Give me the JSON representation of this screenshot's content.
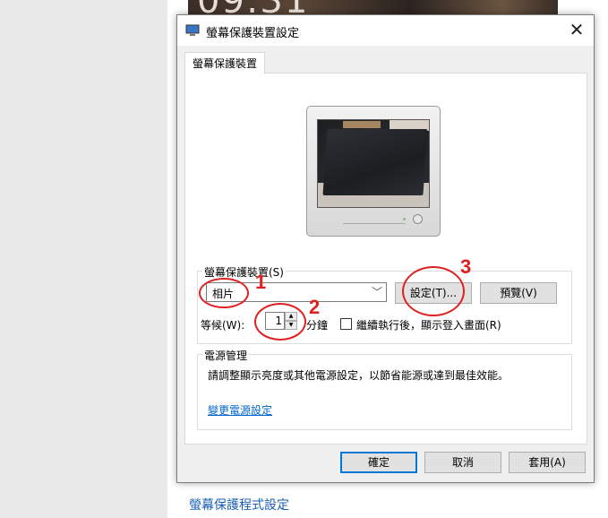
{
  "background": {
    "clock_text": "09:31",
    "screensaver_settings_link": "螢幕保護程式設定"
  },
  "dialog": {
    "title": "螢幕保護裝置設定",
    "close_glyph": "✕",
    "tab_label": "螢幕保護裝置",
    "screensaver_group_label": "螢幕保護裝置(S)",
    "screensaver_selected": "相片",
    "settings_button": "設定(T)...",
    "preview_button": "預覽(V)",
    "wait_label": "等候(W):",
    "wait_value": "1",
    "minutes_label": "分鐘",
    "resume_checkbox_label": "繼續執行後，顯示登入畫面(R)",
    "resume_checked": false,
    "power_group_label": "電源管理",
    "power_description": "請調整顯示亮度或其他電源設定，以節省能源或達到最佳效能。",
    "power_link": "變更電源設定",
    "ok_button": "確定",
    "cancel_button": "取消",
    "apply_button": "套用(A)"
  },
  "annotations": [
    "1",
    "2",
    "3"
  ],
  "colors": {
    "annotation": "#e02020",
    "link": "#0066cc",
    "default_button_border": "#0078d7"
  }
}
